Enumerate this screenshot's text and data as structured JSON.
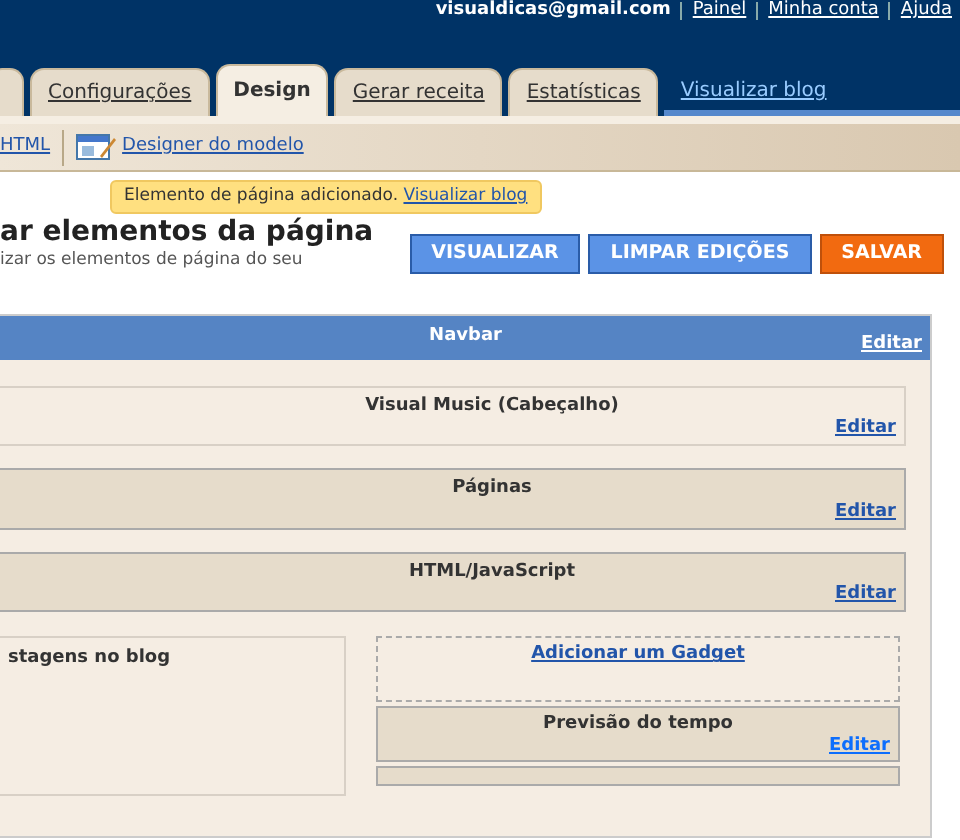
{
  "account_bar": {
    "email": "visualdicas@gmail.com",
    "links": [
      "Painel",
      "Minha conta",
      "Ajuda"
    ]
  },
  "tabs": [
    {
      "selected": false
    },
    {
      "label": "Configurações",
      "selected": false
    },
    {
      "label": "Design",
      "selected": true
    },
    {
      "label": "Gerar receita",
      "selected": false
    },
    {
      "label": "Estatísticas",
      "selected": false
    }
  ],
  "view_blog_link": "Visualizar blog",
  "subnav": [
    {
      "label": "HTML",
      "kind": "link"
    },
    {
      "label": "Designer do modelo",
      "kind": "icon-link"
    }
  ],
  "notice": {
    "text": "Elemento de página adicionado.",
    "link": "Visualizar blog"
  },
  "page_title": "ar elementos da página",
  "page_subtitle": "izar os elementos de página do seu",
  "actions": [
    {
      "label": "VISUALIZAR",
      "kind": "primary"
    },
    {
      "label": "LIMPAR EDIÇÕES",
      "kind": "primary"
    },
    {
      "label": "SALVAR",
      "kind": "save"
    }
  ],
  "layout": {
    "navbar": {
      "title": "Navbar",
      "edit": "Editar"
    },
    "widgets": [
      {
        "title": "Visual Music (Cabeçalho)",
        "edit": "Editar",
        "kind": "light"
      },
      {
        "title": "Páginas",
        "edit": "Editar",
        "kind": "dark"
      },
      {
        "title": "HTML/JavaScript",
        "edit": "Editar",
        "kind": "dark"
      }
    ],
    "main_column": {
      "title": "stagens no blog"
    },
    "sidebar": {
      "add_gadget": "Adicionar um Gadget",
      "widgets": [
        {
          "title": "Previsão do tempo",
          "edit": "Editar"
        }
      ]
    }
  }
}
